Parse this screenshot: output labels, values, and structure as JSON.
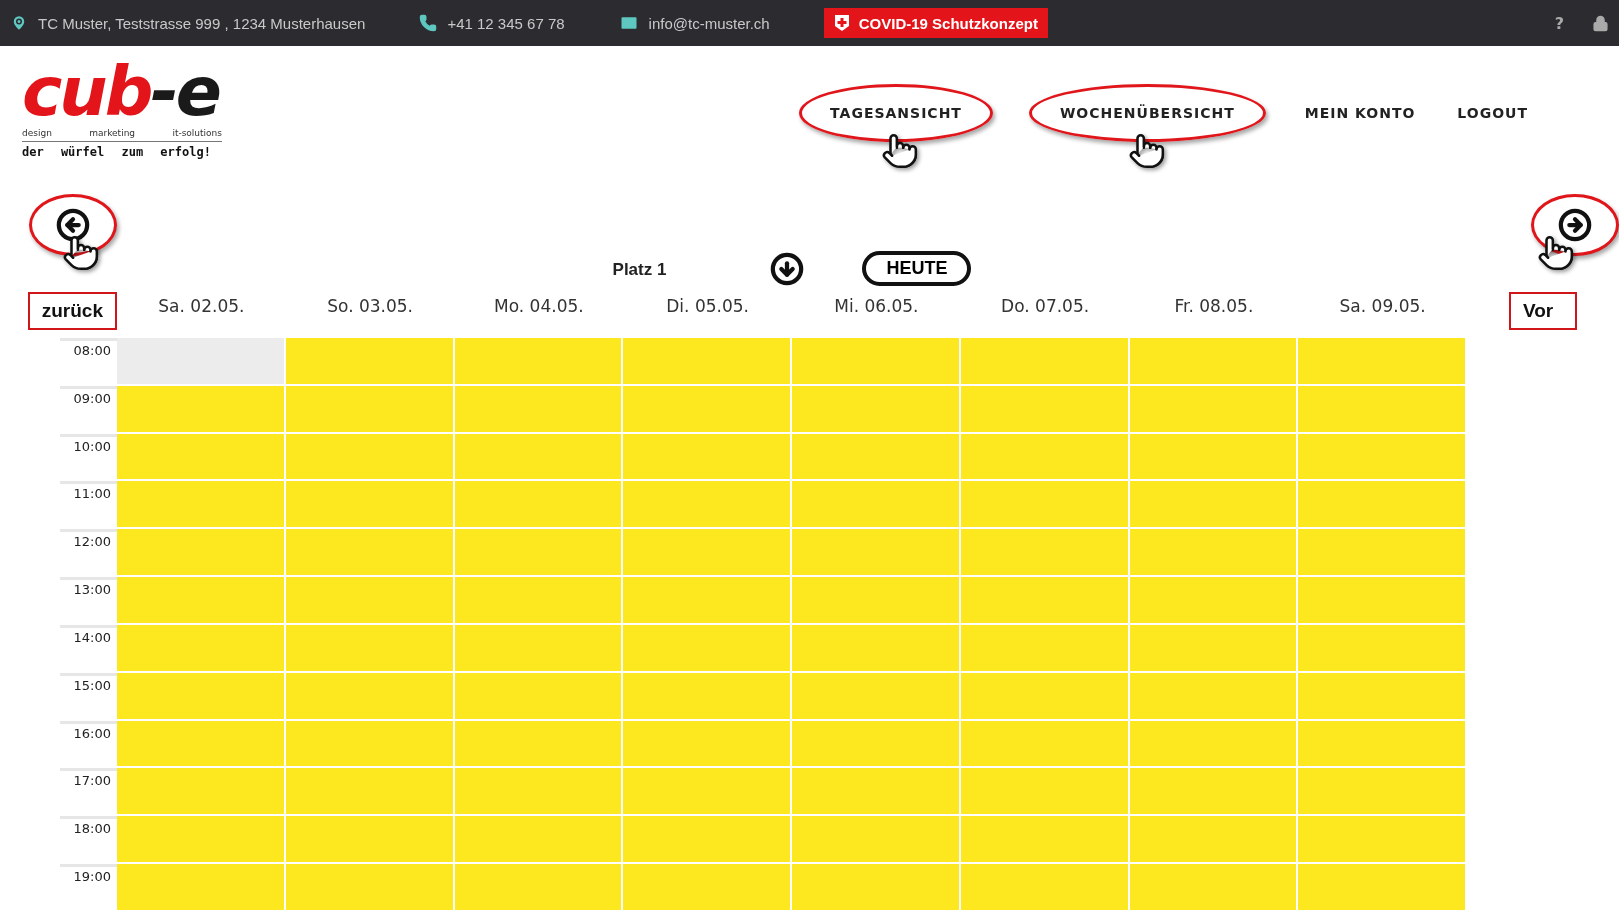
{
  "topbar": {
    "address": "TC Muster, Teststrasse 999 , 1234 Musterhausen",
    "phone": "+41 12 345 67 78",
    "email": "info@tc-muster.ch",
    "covid_button": "COVID-19 Schutzkonzept",
    "help": "?"
  },
  "logo": {
    "parts": [
      {
        "text": "cub",
        "kind": "accent"
      },
      {
        "text": "-e",
        "kind": "plain"
      }
    ],
    "taglines": [
      "design",
      "marketing",
      "it-solutions"
    ],
    "slogan": "der würfel zum erfolg!"
  },
  "nav": [
    {
      "label": "TAGESANSICHT",
      "annotated": true
    },
    {
      "label": "WOCHENÜBERSICHT",
      "annotated": true
    },
    {
      "label": "MEIN KONTO",
      "annotated": false
    },
    {
      "label": "LOGOUT",
      "annotated": false
    }
  ],
  "back": {
    "label": "zurück",
    "annotated": true
  },
  "forward": {
    "label": "Vor",
    "annotated": true
  },
  "court": "Platz 1",
  "today_button": "HEUTE",
  "days": [
    "Sa. 02.05.",
    "So. 03.05.",
    "Mo. 04.05.",
    "Di. 05.05.",
    "Mi. 06.05.",
    "Do. 07.05.",
    "Fr. 08.05.",
    "Sa. 09.05."
  ],
  "rows": [
    {
      "time": "08:00",
      "slots": [
        {
          "free": false
        },
        {
          "free": true
        },
        {
          "free": true
        },
        {
          "free": true
        },
        {
          "free": true
        },
        {
          "free": true
        },
        {
          "free": true
        },
        {
          "free": true
        }
      ]
    },
    {
      "time": "09:00",
      "slots": [
        {
          "free": true
        },
        {
          "free": true
        },
        {
          "free": true
        },
        {
          "free": true
        },
        {
          "free": true
        },
        {
          "free": true
        },
        {
          "free": true
        },
        {
          "free": true
        }
      ]
    },
    {
      "time": "10:00",
      "slots": [
        {
          "free": true
        },
        {
          "free": true
        },
        {
          "free": true
        },
        {
          "free": true
        },
        {
          "free": true
        },
        {
          "free": true
        },
        {
          "free": true
        },
        {
          "free": true
        }
      ]
    },
    {
      "time": "11:00",
      "slots": [
        {
          "free": true
        },
        {
          "free": true
        },
        {
          "free": true
        },
        {
          "free": true
        },
        {
          "free": true
        },
        {
          "free": true
        },
        {
          "free": true
        },
        {
          "free": true
        }
      ]
    },
    {
      "time": "12:00",
      "slots": [
        {
          "free": true
        },
        {
          "free": true
        },
        {
          "free": true
        },
        {
          "free": true
        },
        {
          "free": true
        },
        {
          "free": true
        },
        {
          "free": true
        },
        {
          "free": true
        }
      ]
    },
    {
      "time": "13:00",
      "slots": [
        {
          "free": true
        },
        {
          "free": true
        },
        {
          "free": true
        },
        {
          "free": true
        },
        {
          "free": true
        },
        {
          "free": true
        },
        {
          "free": true
        },
        {
          "free": true
        }
      ]
    },
    {
      "time": "14:00",
      "slots": [
        {
          "free": true
        },
        {
          "free": true
        },
        {
          "free": true
        },
        {
          "free": true
        },
        {
          "free": true
        },
        {
          "free": true
        },
        {
          "free": true
        },
        {
          "free": true
        }
      ]
    },
    {
      "time": "15:00",
      "slots": [
        {
          "free": true
        },
        {
          "free": true
        },
        {
          "free": true
        },
        {
          "free": true
        },
        {
          "free": true
        },
        {
          "free": true
        },
        {
          "free": true
        },
        {
          "free": true
        }
      ]
    },
    {
      "time": "16:00",
      "slots": [
        {
          "free": true
        },
        {
          "free": true
        },
        {
          "free": true
        },
        {
          "free": true
        },
        {
          "free": true
        },
        {
          "free": true
        },
        {
          "free": true
        },
        {
          "free": true
        }
      ]
    },
    {
      "time": "17:00",
      "slots": [
        {
          "free": true
        },
        {
          "free": true
        },
        {
          "free": true
        },
        {
          "free": true
        },
        {
          "free": true
        },
        {
          "free": true
        },
        {
          "free": true
        },
        {
          "free": true
        }
      ]
    },
    {
      "time": "18:00",
      "slots": [
        {
          "free": true
        },
        {
          "free": true
        },
        {
          "free": true
        },
        {
          "free": true
        },
        {
          "free": true
        },
        {
          "free": true
        },
        {
          "free": true
        },
        {
          "free": true
        }
      ]
    },
    {
      "time": "19:00",
      "slots": [
        {
          "free": true
        },
        {
          "free": true
        },
        {
          "free": true
        },
        {
          "free": true
        },
        {
          "free": true
        },
        {
          "free": true
        },
        {
          "free": true
        },
        {
          "free": true
        }
      ]
    }
  ]
}
